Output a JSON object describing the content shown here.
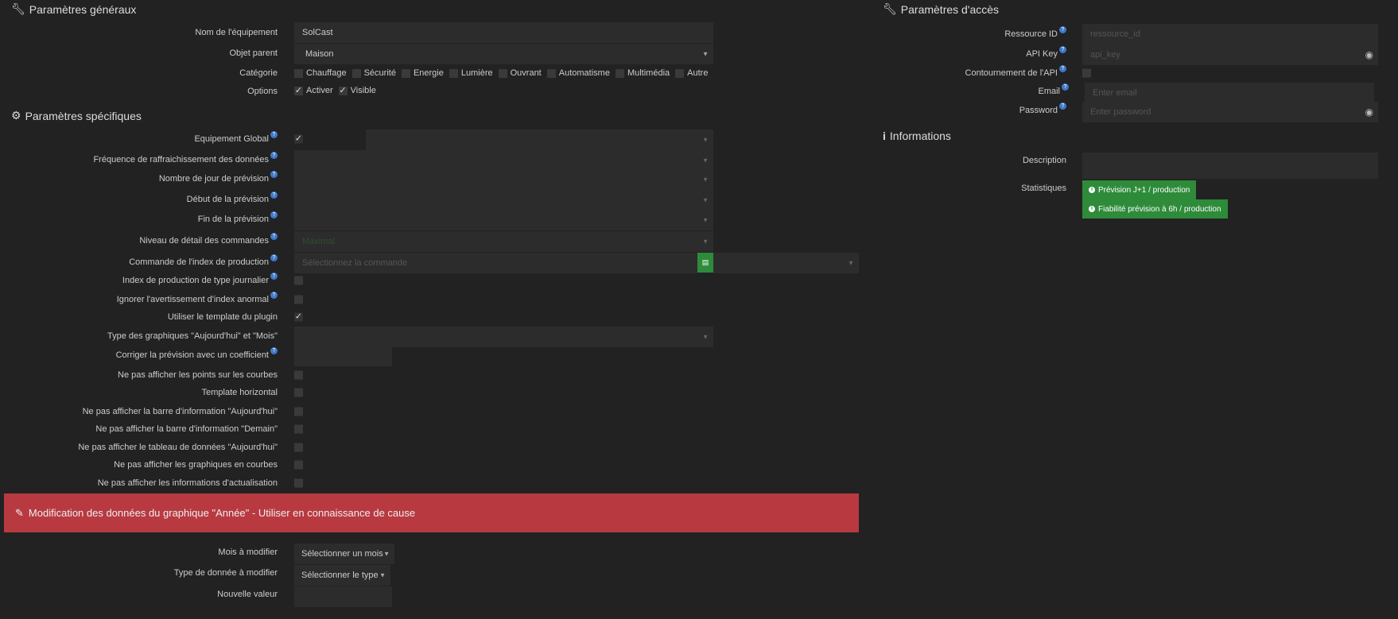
{
  "general": {
    "title": "Paramètres généraux",
    "name_label": "Nom de l'équipement",
    "name_value": "SolCast",
    "parent_label": "Objet parent",
    "parent_value": "Maison",
    "category_label": "Catégorie",
    "categories": [
      {
        "label": "Chauffage",
        "checked": false
      },
      {
        "label": "Sécurité",
        "checked": false
      },
      {
        "label": "Energie",
        "checked": false
      },
      {
        "label": "Lumière",
        "checked": false
      },
      {
        "label": "Ouvrant",
        "checked": false
      },
      {
        "label": "Automatisme",
        "checked": false
      },
      {
        "label": "Multimédia",
        "checked": false
      },
      {
        "label": "Autre",
        "checked": false
      }
    ],
    "options_label": "Options",
    "options": [
      {
        "label": "Activer",
        "checked": true
      },
      {
        "label": "Visible",
        "checked": true
      }
    ]
  },
  "specific": {
    "title": "Paramètres spécifiques",
    "rows": [
      {
        "label": "Equipement Global",
        "help": true,
        "control": "checkbox-select",
        "checked": true,
        "value": ""
      },
      {
        "label": "Fréquence de raffraichissement des données",
        "help": true,
        "control": "select",
        "value": ""
      },
      {
        "label": "Nombre de jour de prévision",
        "help": true,
        "control": "select",
        "value": ""
      },
      {
        "label": "Début de la prévision",
        "help": true,
        "control": "select",
        "value": ""
      },
      {
        "label": "Fin de la prévision",
        "help": true,
        "control": "select",
        "value": ""
      },
      {
        "label": "Niveau de détail des commandes",
        "help": true,
        "control": "select",
        "value": "Maximal"
      },
      {
        "label": "Commande de l'index de production",
        "help": true,
        "control": "cmd",
        "placeholder": "Sélectionnez la commande"
      },
      {
        "label": "Index de production de type journalier",
        "help": true,
        "control": "checkbox",
        "checked": false
      },
      {
        "label": "Ignorer l'avertissement d'index anormal",
        "help": true,
        "control": "checkbox",
        "checked": false
      },
      {
        "label": "Utiliser le template du plugin",
        "help": false,
        "control": "checkbox",
        "checked": true
      },
      {
        "label": "Type des graphiques \"Aujourd'hui\" et \"Mois\"",
        "help": false,
        "control": "select",
        "value": ""
      },
      {
        "label": "Corriger la prévision avec un coefficient",
        "help": true,
        "control": "input",
        "value": ""
      },
      {
        "label": "Ne pas afficher les points sur les courbes",
        "help": false,
        "control": "checkbox",
        "checked": false
      },
      {
        "label": "Template horizontal",
        "help": false,
        "control": "checkbox",
        "checked": false
      },
      {
        "label": "Ne pas afficher la barre d'information \"Aujourd'hui\"",
        "help": false,
        "control": "checkbox",
        "checked": false
      },
      {
        "label": "Ne pas afficher la barre d'information \"Demain\"",
        "help": false,
        "control": "checkbox",
        "checked": false
      },
      {
        "label": "Ne pas afficher le tableau de données \"Aujourd'hui\"",
        "help": false,
        "control": "checkbox",
        "checked": false
      },
      {
        "label": "Ne pas afficher les graphiques en courbes",
        "help": false,
        "control": "checkbox",
        "checked": false
      },
      {
        "label": "Ne pas afficher les informations d'actualisation",
        "help": false,
        "control": "checkbox",
        "checked": false
      }
    ]
  },
  "warning": {
    "text": "Modification des données du graphique \"Année\" - Utiliser en connaissance de cause",
    "color": "#b83a40"
  },
  "year_edit": {
    "month_label": "Mois à modifier",
    "month_value": "Sélectionner un mois",
    "type_label": "Type de donnée à modifier",
    "type_value": "Sélectionner le type",
    "new_value_label": "Nouvelle valeur",
    "new_value": ""
  },
  "access": {
    "title": "Paramètres d'accès",
    "resource_label": "Ressource ID",
    "resource_placeholder": "ressource_id",
    "apikey_label": "API Key",
    "apikey_placeholder": "api_key",
    "bypass_label": "Contournement de l'API",
    "email_label": "Email",
    "email_placeholder": "Enter email",
    "password_label": "Password",
    "password_placeholder": "Enter password"
  },
  "info": {
    "title": "Informations",
    "description_label": "Description",
    "stats_label": "Statistiques",
    "stats_buttons": [
      "Prévision J+1 / production",
      "Fiabilité prévision à 6h / production"
    ],
    "accent": "#2e8b3a"
  }
}
